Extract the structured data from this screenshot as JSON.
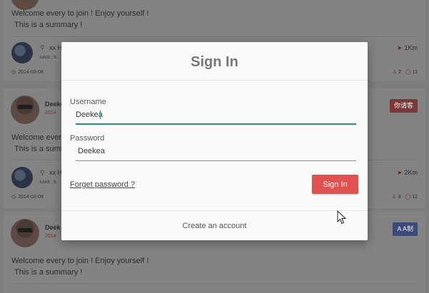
{
  "feed": {
    "cards": [
      {
        "summary_line1": "Welcome every to join !  Enjoy yourself !",
        "summary_line2": "This is a summary !",
        "location": "xx H",
        "location_sub": "lunch , h",
        "distance": "1Km",
        "date": "2014-03-08",
        "likes": "2",
        "comments": "11"
      },
      {
        "user_name": "Deeke",
        "user_sub": "2014",
        "badge": "你请客",
        "summary_line1": "Welcome every to join !  Enjoy yourself !",
        "summary_line2": "This is a summary !",
        "location": "xx H",
        "location_sub": "lunch , h",
        "distance": "2Km",
        "date": "2014-03-08",
        "likes": "3",
        "comments": "12"
      },
      {
        "user_name": "Deek",
        "user_sub": "2014",
        "badge": "A A制",
        "summary_line1": "Welcome every to join !  Enjoy yourself !",
        "summary_line2": "This is a summary !"
      }
    ]
  },
  "dialog": {
    "title": "Sign In",
    "username_label": "Username",
    "username_value": "Deekea",
    "password_label": "Password",
    "password_value": "Deekea",
    "forgot_label": "Forget password ?",
    "signin_label": "Sign In",
    "create_label": "Create an account"
  },
  "colors": {
    "accent": "#2a8f7e",
    "primary_button": "#e05252",
    "overlay": "#7d7d7d"
  },
  "icons": {
    "location": "location-pin-icon",
    "navigation": "navigation-arrow-icon",
    "clock": "clock-icon",
    "people": "people-icon",
    "comment": "comment-icon"
  }
}
